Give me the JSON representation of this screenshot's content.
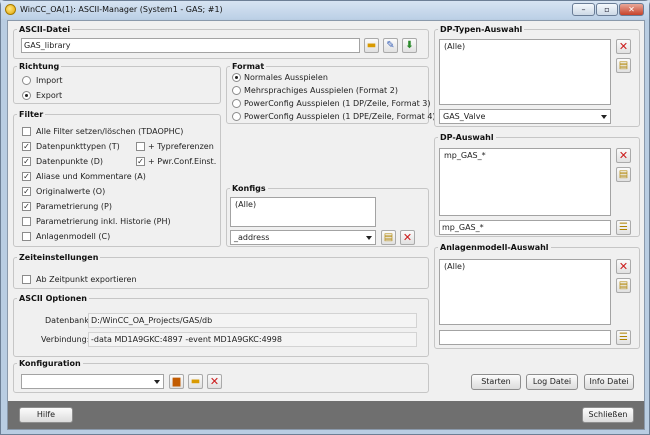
{
  "window": {
    "title": "WinCC_OA(1): ASCII-Manager (System1 - GAS; #1)",
    "min": "–",
    "max": "▫",
    "close": "✕"
  },
  "ascii_datei": {
    "legend": "ASCII-Datei",
    "value": "GAS_library"
  },
  "richtung": {
    "legend": "Richtung",
    "options": [
      "Import",
      "Export"
    ],
    "selected": "Export"
  },
  "format": {
    "legend": "Format",
    "options": [
      "Normales Ausspielen",
      "Mehrsprachiges Ausspielen (Format 2)",
      "PowerConfig Ausspielen (1 DP/Zeile, Format 3)",
      "PowerConfig Ausspielen (1 DPE/Zeile, Format 4)"
    ],
    "selected": "Normales Ausspielen"
  },
  "filter": {
    "legend": "Filter",
    "items": [
      {
        "label": "Alle Filter setzen/löschen (TDAOPHC)",
        "checked": false
      },
      {
        "label": "Datenpunkttypen (T)",
        "checked": true
      },
      {
        "label": "Datenpunkte (D)",
        "checked": true
      },
      {
        "label": "Aliase und Kommentare (A)",
        "checked": true
      },
      {
        "label": "Originalwerte (O)",
        "checked": true
      },
      {
        "label": "Parametrierung (P)",
        "checked": true
      },
      {
        "label": "Parametrierung inkl. Historie (PH)",
        "checked": false
      },
      {
        "label": "Anlagenmodell  (C)",
        "checked": false
      }
    ],
    "extra": [
      {
        "label": "+ Typreferenzen",
        "checked": false
      },
      {
        "label": "+ Pwr.Conf.Einst.",
        "checked": true
      }
    ]
  },
  "konfigs": {
    "legend": "Konfigs",
    "list": [
      "(Alle)"
    ],
    "combo_value": "_address"
  },
  "zeiteinstellungen": {
    "legend": "Zeiteinstellungen",
    "checkbox_label": "Ab Zeitpunkt exportieren",
    "checked": false
  },
  "ascii_optionen": {
    "legend": "ASCII Optionen",
    "datenbank_label": "Datenbank:",
    "datenbank_value": "D:/WinCC_OA_Projects/GAS/db",
    "verbindung_label": "Verbindung:",
    "verbindung_value": "-data MD1A9GKC:4897 -event MD1A9GKC:4998"
  },
  "konfiguration": {
    "legend": "Konfiguration",
    "combo_value": ""
  },
  "dp_typen": {
    "legend": "DP-Typen-Auswahl",
    "list": [
      "(Alle)"
    ],
    "combo_value": "GAS_Valve"
  },
  "dp_auswahl": {
    "legend": "DP-Auswahl",
    "list": [
      "mp_GAS_*"
    ],
    "input_value": "mp_GAS_*"
  },
  "anlagenmodell": {
    "legend": "Anlagenmodell-Auswahl",
    "list": [
      "(Alle)"
    ],
    "input_value": ""
  },
  "buttons": {
    "starten": "Starten",
    "log_datei": "Log Datei",
    "info_datei": "Info Datei",
    "hilfe": "Hilfe",
    "schliessen": "Schließen"
  },
  "icons": {
    "delete": "✕",
    "folder": "📂",
    "save": "💾",
    "notepad": "📋",
    "edit": "✎"
  }
}
